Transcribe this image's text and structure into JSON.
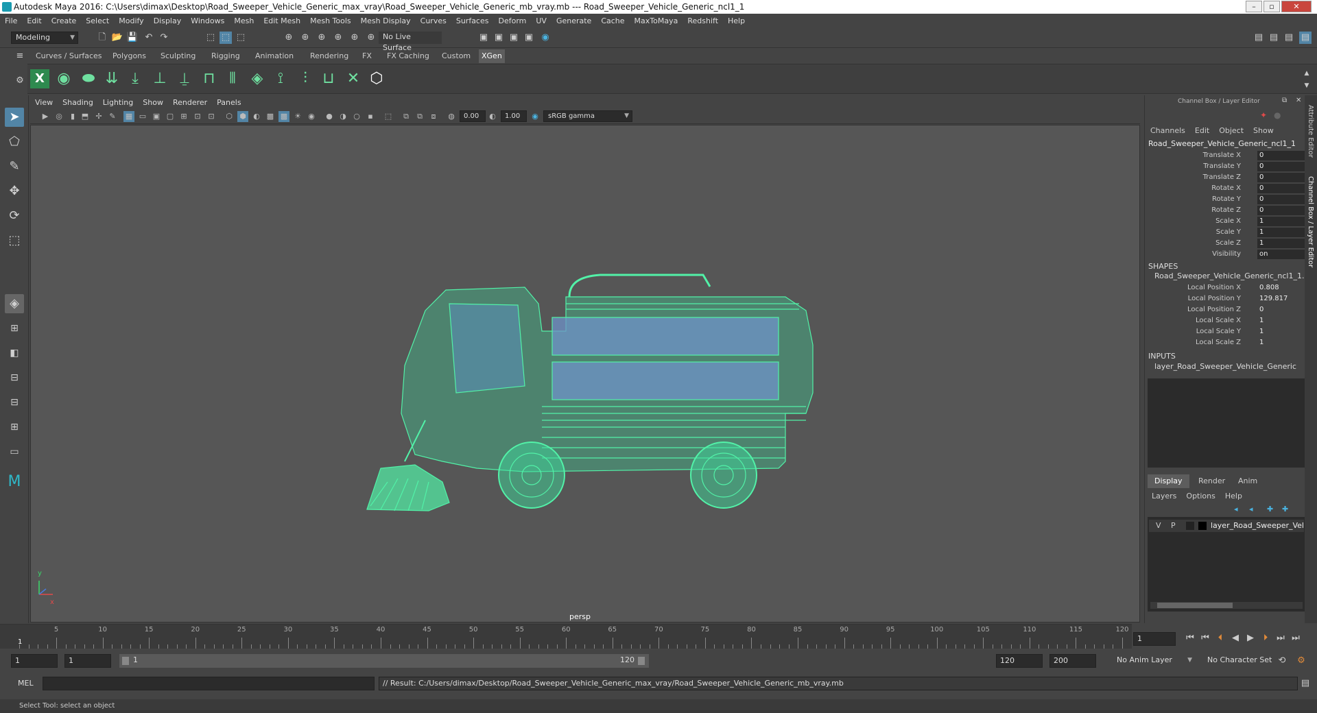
{
  "title": "Autodesk Maya 2016: C:\\Users\\dimax\\Desktop\\Road_Sweeper_Vehicle_Generic_max_vray\\Road_Sweeper_Vehicle_Generic_mb_vray.mb  ---  Road_Sweeper_Vehicle_Generic_ncl1_1",
  "menu": [
    "File",
    "Edit",
    "Create",
    "Select",
    "Modify",
    "Display",
    "Windows",
    "Mesh",
    "Edit Mesh",
    "Mesh Tools",
    "Mesh Display",
    "Curves",
    "Surfaces",
    "Deform",
    "UV",
    "Generate",
    "Cache",
    "MaxToMaya",
    "Redshift",
    "Help"
  ],
  "statusline": {
    "mode": "Modeling",
    "live_surface": "No Live Surface"
  },
  "shelf_tabs": [
    "Curves / Surfaces",
    "Polygons",
    "Sculpting",
    "Rigging",
    "Animation",
    "Rendering",
    "FX",
    "FX Caching",
    "Custom",
    "XGen"
  ],
  "active_shelf_tab": "XGen",
  "viewport": {
    "menu": [
      "View",
      "Shading",
      "Lighting",
      "Show",
      "Renderer",
      "Panels"
    ],
    "exposure": "0.00",
    "gamma": "1.00",
    "color_space": "sRGB gamma",
    "camera": "persp",
    "axis_x": "x",
    "axis_y": "y"
  },
  "channel_box": {
    "title": "Channel Box / Layer Editor",
    "menu": [
      "Channels",
      "Edit",
      "Object",
      "Show"
    ],
    "object": "Road_Sweeper_Vehicle_Generic_ncl1_1",
    "channels": [
      {
        "label": "Translate X",
        "value": "0"
      },
      {
        "label": "Translate Y",
        "value": "0"
      },
      {
        "label": "Translate Z",
        "value": "0"
      },
      {
        "label": "Rotate X",
        "value": "0"
      },
      {
        "label": "Rotate Y",
        "value": "0"
      },
      {
        "label": "Rotate Z",
        "value": "0"
      },
      {
        "label": "Scale X",
        "value": "1"
      },
      {
        "label": "Scale Y",
        "value": "1"
      },
      {
        "label": "Scale Z",
        "value": "1"
      },
      {
        "label": "Visibility",
        "value": "on"
      }
    ],
    "shapes_header": "SHAPES",
    "shape_name": "Road_Sweeper_Vehicle_Generic_ncl1_1...",
    "shape_channels": [
      {
        "label": "Local Position X",
        "value": "0.808"
      },
      {
        "label": "Local Position Y",
        "value": "129.817"
      },
      {
        "label": "Local Position Z",
        "value": "0"
      },
      {
        "label": "Local Scale X",
        "value": "1"
      },
      {
        "label": "Local Scale Y",
        "value": "1"
      },
      {
        "label": "Local Scale Z",
        "value": "1"
      }
    ],
    "inputs_header": "INPUTS",
    "input_name": "layer_Road_Sweeper_Vehicle_Generic"
  },
  "layer_editor": {
    "tabs": [
      "Display",
      "Render",
      "Anim"
    ],
    "active_tab": "Display",
    "menu": [
      "Layers",
      "Options",
      "Help"
    ],
    "layer": {
      "v": "V",
      "p": "P",
      "name": "layer_Road_Sweeper_Vel"
    }
  },
  "side_tabs": [
    "Attribute Editor",
    "Channel Box / Layer Editor"
  ],
  "timeline": {
    "ticks": [
      "5",
      "10",
      "15",
      "20",
      "25",
      "30",
      "35",
      "40",
      "45",
      "50",
      "55",
      "60",
      "65",
      "70",
      "75",
      "80",
      "85",
      "90",
      "95",
      "100",
      "105",
      "110",
      "115",
      "120"
    ],
    "current": "1",
    "current_frame_field": "1"
  },
  "range": {
    "start": "1",
    "start2": "1",
    "slider_start": "1",
    "slider_end": "120",
    "end": "120",
    "end2": "200",
    "anim_layer": "No Anim Layer",
    "char_set": "No Character Set"
  },
  "cmdline": {
    "lang": "MEL",
    "result": "// Result: C:/Users/dimax/Desktop/Road_Sweeper_Vehicle_Generic_max_vray/Road_Sweeper_Vehicle_Generic_mb_vray.mb"
  },
  "help_line": "Select Tool: select an object"
}
